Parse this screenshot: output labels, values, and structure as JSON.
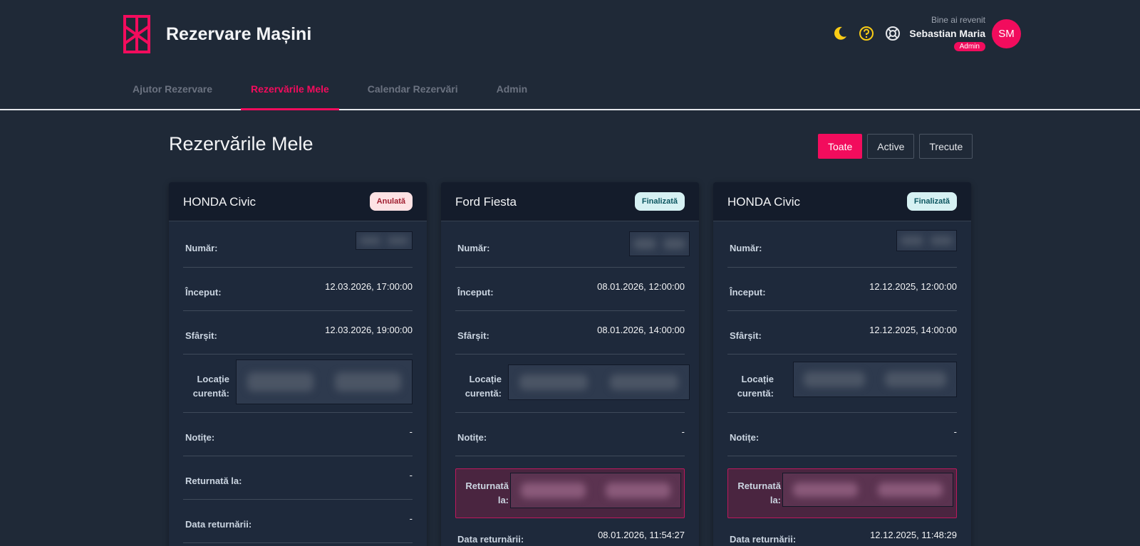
{
  "app": {
    "title": "Rezervare Mașini",
    "accent_color": "#f20c5d"
  },
  "header": {
    "icons": [
      "moon-icon",
      "help-circle-icon",
      "lifebuoy-icon"
    ],
    "welcome": "Bine ai revenit",
    "user_name": "Sebastian Maria",
    "role": "Admin",
    "avatar_initials": "SM"
  },
  "nav": {
    "tabs": [
      {
        "label": "Ajutor Rezervare",
        "active": false
      },
      {
        "label": "Rezervările Mele",
        "active": true
      },
      {
        "label": "Calendar Rezervări",
        "active": false
      },
      {
        "label": "Admin",
        "active": false
      }
    ]
  },
  "main": {
    "title": "Rezervările Mele",
    "filters": [
      {
        "label": "Toate",
        "active": true
      },
      {
        "label": "Active",
        "active": false
      },
      {
        "label": "Trecute",
        "active": false
      }
    ]
  },
  "labels": {
    "number": "Număr:",
    "start": "Început:",
    "end": "Sfârșit:",
    "location": "Locație curentă:",
    "notes": "Notițe:",
    "returned_at": "Returnată la:",
    "return_date": "Data returnării:"
  },
  "cards": [
    {
      "car": "HONDA Civic",
      "status": "Anulată",
      "start": "12.03.2026, 17:00:00",
      "end": "12.03.2026, 19:00:00",
      "notes": "-",
      "returned_at": "-",
      "return_date": "-"
    },
    {
      "car": "Ford Fiesta",
      "status": "Finalizată",
      "start": "08.01.2026, 12:00:00",
      "end": "08.01.2026, 14:00:00",
      "notes": "-",
      "return_date": "08.01.2026, 11:54:27"
    },
    {
      "car": "HONDA Civic",
      "status": "Finalizată",
      "start": "12.12.2025, 12:00:00",
      "end": "12.12.2025, 14:00:00",
      "notes": "-",
      "return_date": "12.12.2025, 11:48:29"
    }
  ]
}
